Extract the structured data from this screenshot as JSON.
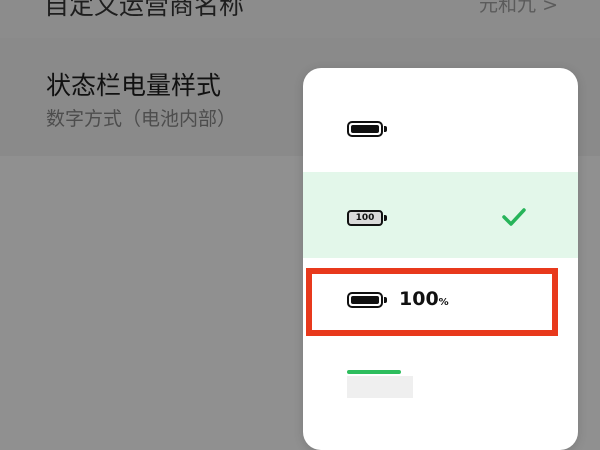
{
  "background": {
    "top_row": {
      "title": "自定义运营商名称",
      "value": "元和九 >"
    },
    "setting": {
      "title": "状态栏电量样式",
      "subtitle": "数字方式（电池内部）"
    }
  },
  "menu": {
    "options": [
      {
        "name": "icon-only",
        "icon": "battery-icon",
        "selected": false
      },
      {
        "name": "number-inside",
        "icon": "battery-with-number-icon",
        "battery_text": "100",
        "selected": true
      },
      {
        "name": "number-beside",
        "icon": "battery-icon",
        "text": "100",
        "unit": "%",
        "selected": false
      },
      {
        "name": "bar",
        "icon": "battery-bar-icon",
        "selected": false
      }
    ],
    "selected_color": "#e3f7ea",
    "check_color": "#27b45a"
  },
  "annotation": {
    "color": "#e8391c"
  }
}
